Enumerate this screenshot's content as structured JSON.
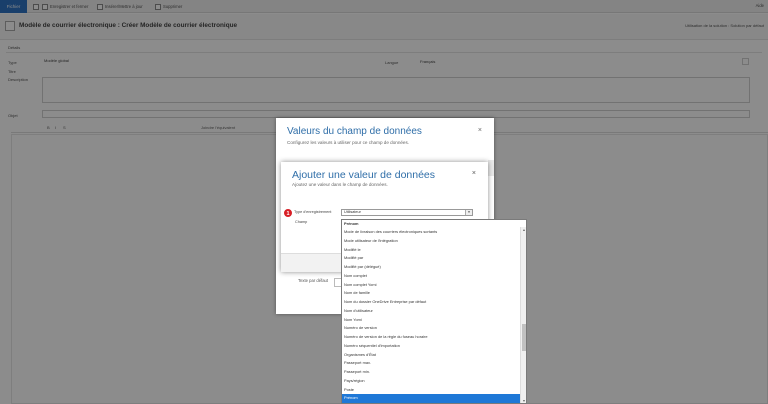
{
  "toolbar": {
    "file": "Fichier",
    "save_close": "Enregistrer et fermer",
    "insert_template": "Insérer/Mettre à jour",
    "delete": "Supprimer",
    "help": "Aide"
  },
  "header": {
    "title": "Modèle de courrier électronique : Créer Modèle de courrier électronique",
    "solution": "Utilisation de la solution : Solution par défaut"
  },
  "form": {
    "details": "Détails",
    "type_label": "Type",
    "type_value": "Modèle global",
    "title_label": "Titre",
    "description_label": "Description",
    "language_label": "Langue",
    "language_value": "Français",
    "subject_label": "Objet",
    "attach_label": "Joindre l'équivalent",
    "format_tools": [
      "B",
      "I",
      "S"
    ]
  },
  "dialog1": {
    "title": "Valeurs du champ de données",
    "subtitle": "Configurez les valeurs à utiliser pour ce champ de données.",
    "default_text_label": "Texte par défaut",
    "close": "×"
  },
  "dialog2": {
    "title": "Ajouter une valeur de données",
    "subtitle": "Ajoutez une valeur dans le champ de données.",
    "record_type_label": "Type d'enregistrement",
    "record_type_value": "Utilisateur",
    "field_label": "Champ",
    "close": "×"
  },
  "badges": {
    "b1": "1",
    "b2": "2"
  },
  "dropdown": {
    "current": "Prénom",
    "items": [
      "Mode de livraison des courriers électroniques sortants",
      "Mode utilisateur de l'intégration",
      "Modifié le",
      "Modifié par",
      "Modifié par (délégué)",
      "Nom complet",
      "Nom complet Yomi",
      "Nom de famille",
      "Nom du dossier OneDrive Entreprise par défaut",
      "Nom d'utilisateur",
      "Nom Yomi",
      "Numéro de version",
      "Numéro de version de la règle du fuseau horaire",
      "Numéro séquentiel d'importation",
      "Organismes d'État",
      "Passeport max.",
      "Passeport min.",
      "Pays/région",
      "Poste",
      "Prénom"
    ],
    "selected_index": 19
  },
  "colors": {
    "accent": "#2f74c4",
    "badge": "#d81f26",
    "selected": "#1e78d7"
  }
}
